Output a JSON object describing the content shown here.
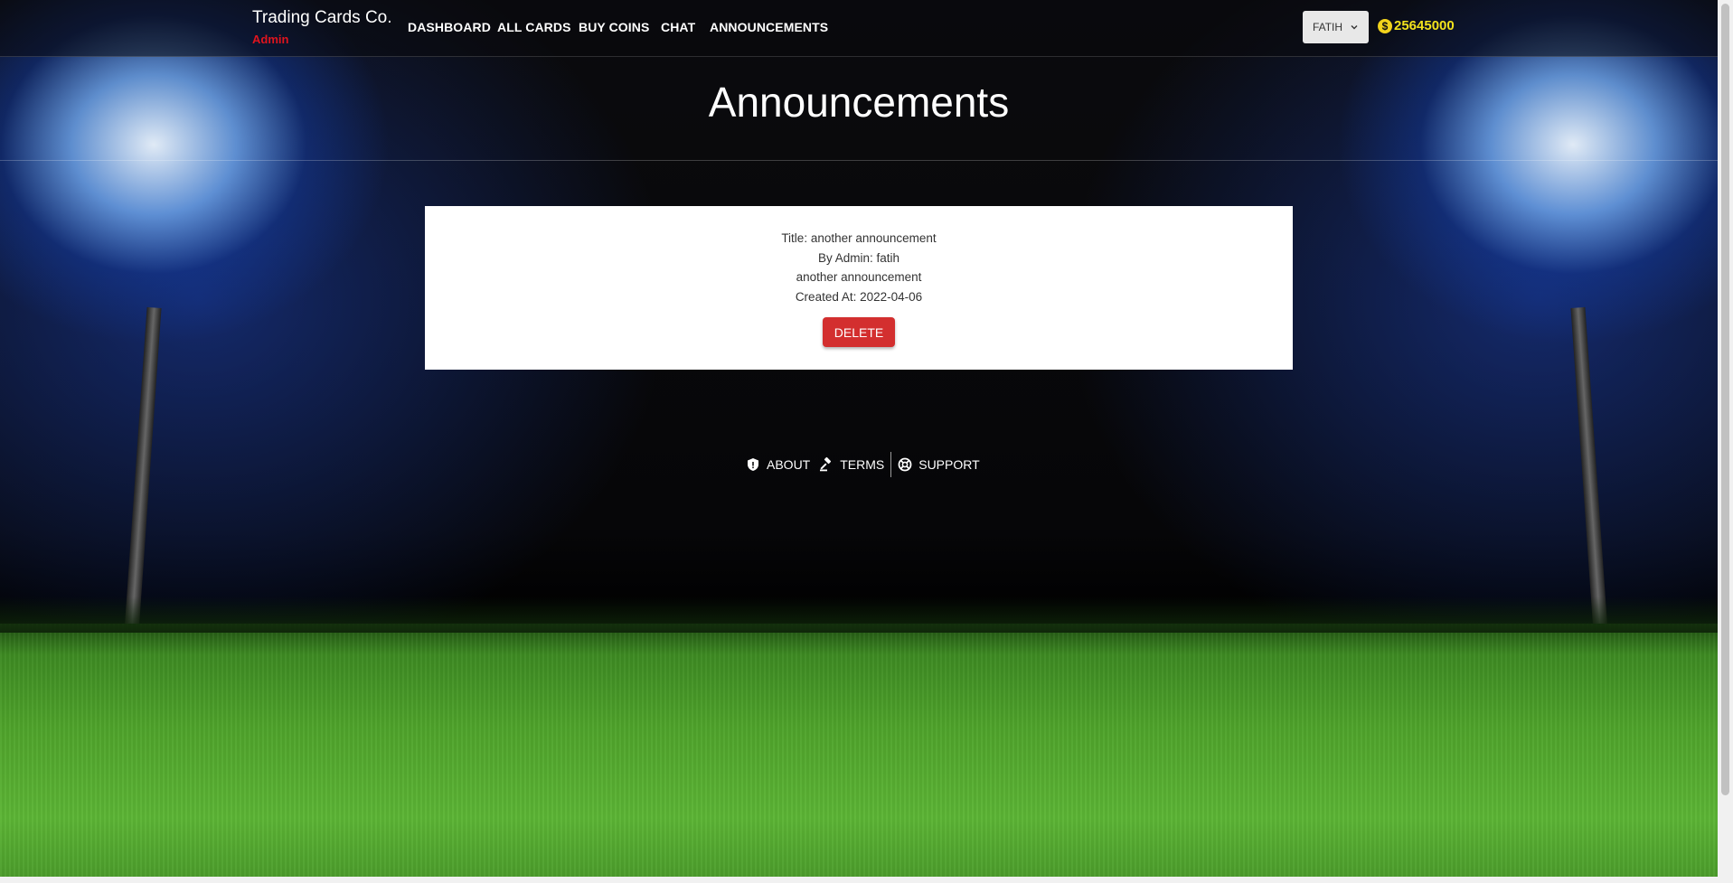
{
  "navbar": {
    "brand": "Trading Cards Co.",
    "role": "Admin",
    "links": [
      "DASHBOARD",
      "ALL CARDS",
      "BUY COINS",
      "CHAT",
      "ANNOUNCEMENTS"
    ],
    "user_label": "FATIH",
    "coins": "25645000",
    "coin_symbol": "$"
  },
  "page": {
    "title": "Announcements"
  },
  "announcement": {
    "title_line": "Title: another announcement",
    "author_line": "By Admin: fatih",
    "body": "another announcement",
    "created_line": "Created At: 2022-04-06",
    "delete_label": "DELETE"
  },
  "footer": {
    "about": "ABOUT",
    "terms": "TERMS",
    "support": "SUPPORT"
  },
  "colors": {
    "accent_red": "#d32f2f",
    "role_red": "#e0141e",
    "coin_yellow": "#f2e21c"
  },
  "icons": {
    "user_dropdown": "chevron-down-icon",
    "coin": "dollar-coin-icon",
    "about": "shield-icon",
    "terms": "gavel-icon",
    "support": "lifebuoy-icon"
  }
}
